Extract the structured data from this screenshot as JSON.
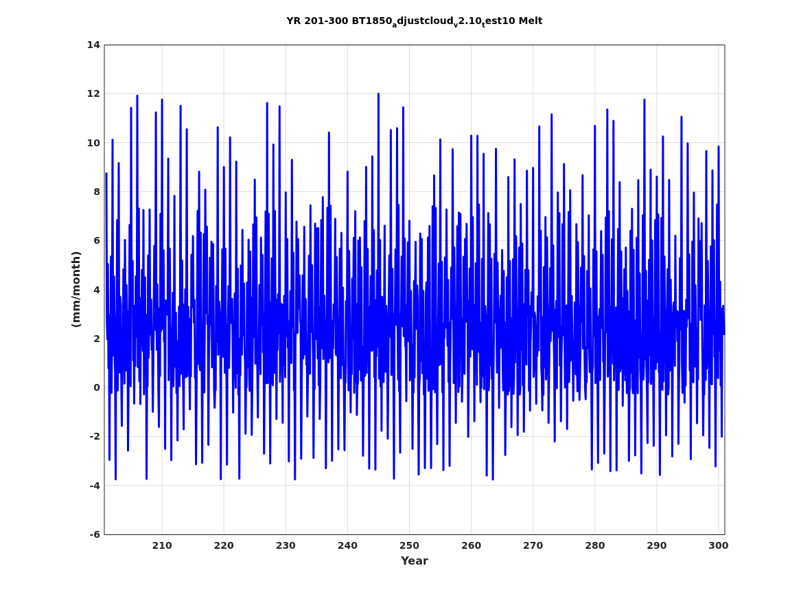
{
  "figure": {
    "title": "YR 201-300 BT1850$_{a}$djustcloud$_{v}$2.10$_{t}$est10 Melt",
    "ylabel": "(mm/month)",
    "xlabel": "Year",
    "yticks": [
      "14",
      "12",
      "10",
      "8",
      "6",
      "4",
      "2",
      "0",
      "-2",
      "-4",
      "-6"
    ],
    "xticks": [
      "210",
      "220",
      "230",
      "240",
      "250",
      "260",
      "270",
      "280",
      "290",
      "300"
    ]
  }
}
